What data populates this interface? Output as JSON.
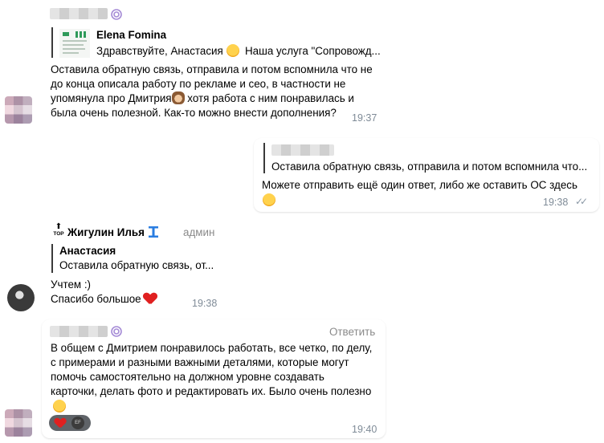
{
  "msg1": {
    "reply_to_name": "Elena Fomina",
    "reply_to_text": "Здравствуйте, Анастасия",
    "reply_to_text2": "Наша услуга \"Сопровожд...",
    "lines": [
      "Оставила обратную связь, отправила и потом вспомнила что не",
      "до конца описала работу по рекламе и сео, в частности не",
      "упомянула про Дмитрия",
      "хотя работа с ним понравилась и",
      "была очень полезной. Как-то можно внести дополнения?"
    ],
    "time": "19:37"
  },
  "msg2": {
    "quote_text": "Оставила обратную связь, отправила и потом вспомнила что...",
    "line1": "Можете отправить ещё один ответ, либо же оставить ОС здесь",
    "time": "19:38",
    "ticks": "✓✓"
  },
  "msg3": {
    "top_badge": "TOP",
    "author": "Жигулин Илья",
    "role": "админ",
    "reply_to_name": "Анастасия",
    "reply_to_text": "Оставила обратную связь, от...",
    "line1": "Учтем :)",
    "line2": "Спасибо большое",
    "time": "19:38"
  },
  "msg4": {
    "reply_button": "Ответить",
    "lines": [
      "В общем с Дмитрием понравилось работать, все четко, по делу,",
      "с примерами и разными важными деталями, которые могут",
      "помочь самостоятельно на должном уровне создавать",
      "карточки, делать фото и редактировать их. Было очень полезно"
    ],
    "reaction_avatar_initials": "EF",
    "time": "19:40"
  }
}
